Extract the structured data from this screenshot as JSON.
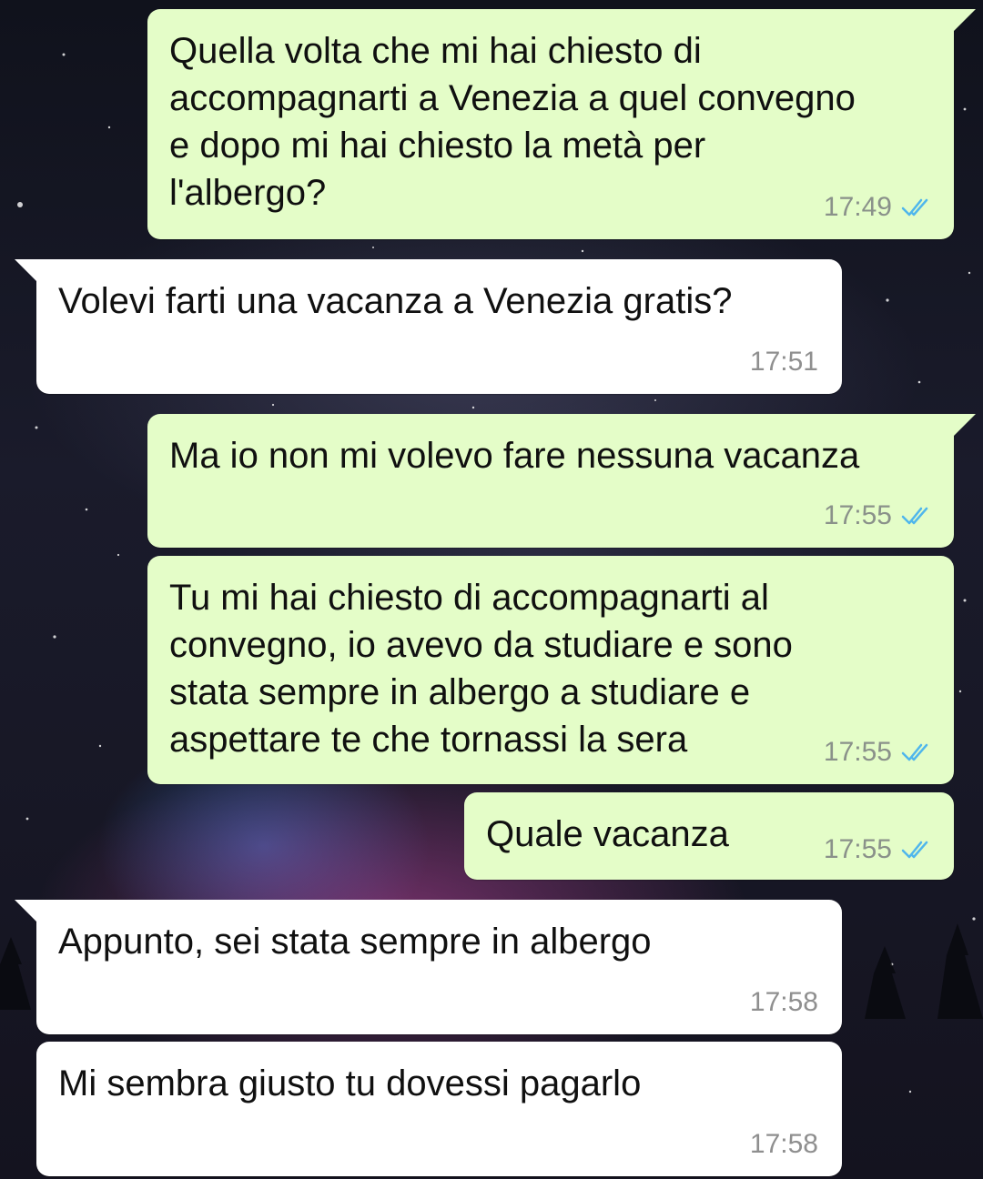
{
  "messages": [
    {
      "direction": "outgoing",
      "text": "Quella volta che mi hai chiesto di\naccompagnarti a Venezia a quel convegno\ne dopo mi hai chiesto la metà per\nl'albergo?",
      "time": "17:49",
      "status_icon": "double-check-read-icon"
    },
    {
      "direction": "incoming",
      "text": "Volevi farti una vacanza a Venezia gratis?",
      "time": "17:51"
    },
    {
      "direction": "outgoing",
      "text": "Ma io non mi volevo fare nessuna vacanza",
      "time": "17:55",
      "status_icon": "double-check-read-icon"
    },
    {
      "direction": "outgoing",
      "text": "Tu mi hai chiesto di accompagnarti al\nconvegno, io avevo da studiare e sono\nstata sempre in albergo a studiare e\naspettare te che tornassi la sera",
      "time": "17:55",
      "status_icon": "double-check-read-icon"
    },
    {
      "direction": "outgoing",
      "text": "Quale vacanza",
      "time": "17:55",
      "status_icon": "double-check-read-icon"
    },
    {
      "direction": "incoming",
      "text": "Appunto, sei stata sempre in albergo",
      "time": "17:58"
    },
    {
      "direction": "incoming",
      "text": "Mi sembra giusto tu dovessi pagarlo",
      "time": "17:58"
    }
  ],
  "colors": {
    "outgoing_bubble": "#e4fdc8",
    "incoming_bubble": "#ffffff",
    "read_ticks": "#4fb6ec"
  }
}
